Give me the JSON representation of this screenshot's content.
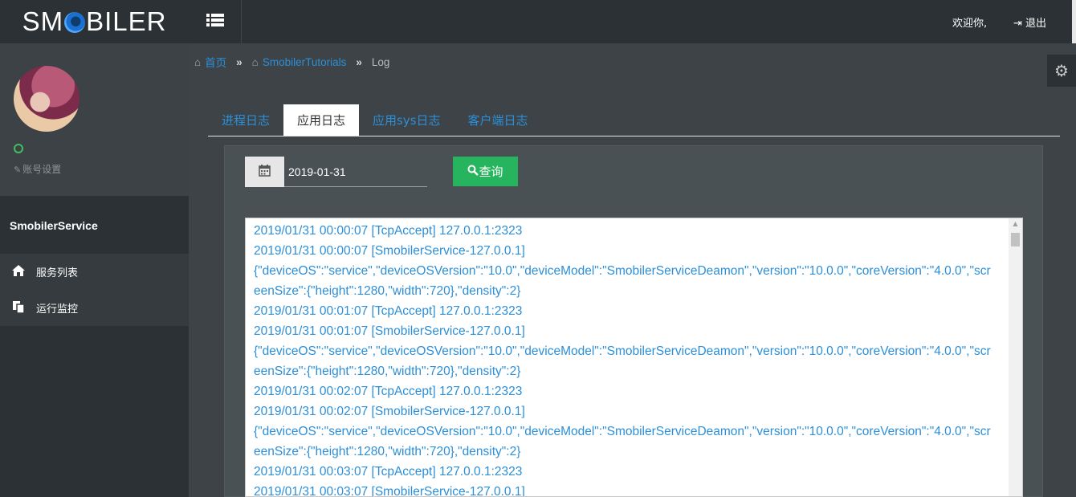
{
  "app": {
    "logo_left": "SM",
    "logo_right": "BILER"
  },
  "topbar": {
    "welcome": "欢迎你,",
    "logout": "退出"
  },
  "sidebar": {
    "account_settings": "账号设置",
    "service_title": "SmobilerService",
    "items": [
      {
        "label": "服务列表",
        "icon": "home-icon"
      },
      {
        "label": "运行监控",
        "icon": "copy-icon"
      }
    ]
  },
  "breadcrumb": {
    "home": "首页",
    "project": "SmobilerTutorials",
    "current": "Log",
    "separator": "»"
  },
  "tabs": [
    {
      "label": "进程日志",
      "active": false
    },
    {
      "label": "应用日志",
      "active": true
    },
    {
      "label": "应用sys日志",
      "active": false
    },
    {
      "label": "客户端日志",
      "active": false
    }
  ],
  "filter": {
    "date_value": "2019-01-31",
    "query_label": "查询"
  },
  "log_lines": [
    "2019/01/31 00:00:07 [TcpAccept] 127.0.0.1:2323",
    "2019/01/31 00:00:07 [SmobilerService-127.0.0.1]",
    "{\"deviceOS\":\"service\",\"deviceOSVersion\":\"10.0\",\"deviceModel\":\"SmobilerServiceDeamon\",\"version\":\"10.0.0\",\"coreVersion\":\"4.0.0\",\"scr",
    "eenSize\":{\"height\":1280,\"width\":720},\"density\":2}",
    "2019/01/31 00:01:07 [TcpAccept] 127.0.0.1:2323",
    "2019/01/31 00:01:07 [SmobilerService-127.0.0.1]",
    "{\"deviceOS\":\"service\",\"deviceOSVersion\":\"10.0\",\"deviceModel\":\"SmobilerServiceDeamon\",\"version\":\"10.0.0\",\"coreVersion\":\"4.0.0\",\"scr",
    "eenSize\":{\"height\":1280,\"width\":720},\"density\":2}",
    "2019/01/31 00:02:07 [TcpAccept] 127.0.0.1:2323",
    "2019/01/31 00:02:07 [SmobilerService-127.0.0.1]",
    "{\"deviceOS\":\"service\",\"deviceOSVersion\":\"10.0\",\"deviceModel\":\"SmobilerServiceDeamon\",\"version\":\"10.0.0\",\"coreVersion\":\"4.0.0\",\"scr",
    "eenSize\":{\"height\":1280,\"width\":720},\"density\":2}",
    "2019/01/31 00:03:07 [TcpAccept] 127.0.0.1:2323",
    "2019/01/31 00:03:07 [SmobilerService-127.0.0.1]"
  ],
  "colors": {
    "accent": "#2c8fd8",
    "query_button": "#26b45e",
    "status_online": "#3fbf5f"
  }
}
